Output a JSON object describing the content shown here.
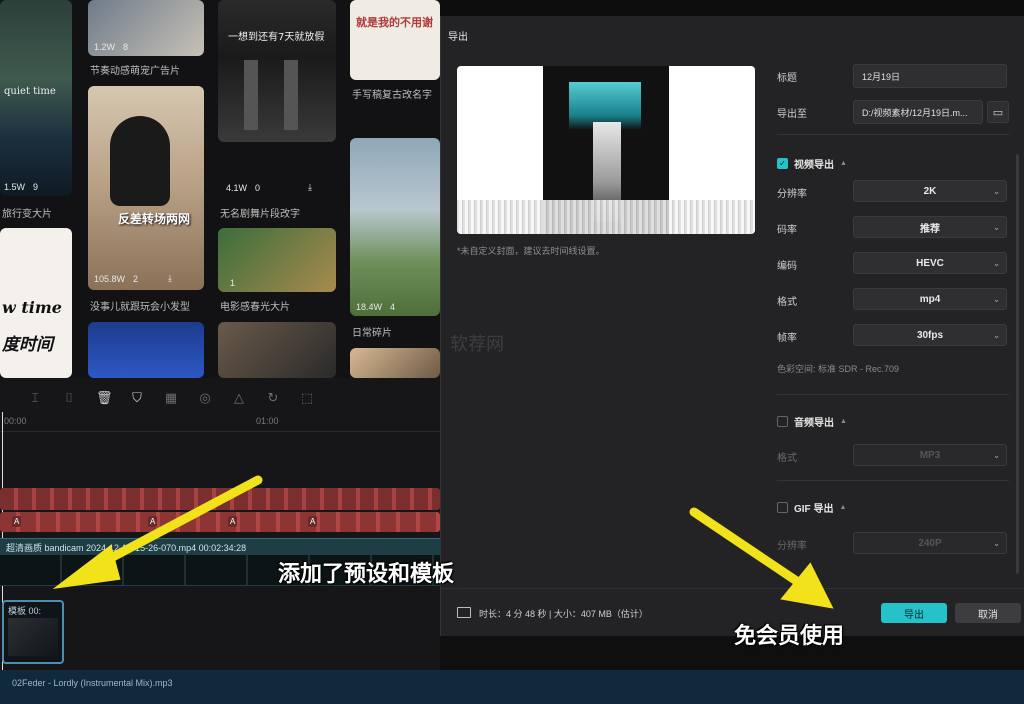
{
  "background": {
    "cards": [
      {
        "caption": "节奏动感萌宠广告片",
        "meta_uses": "1.2W",
        "meta_count": "8"
      },
      {
        "caption": "",
        "overlay": "一想到还有7天就放假"
      },
      {
        "caption": "手写稿复古改名字",
        "overlay": "就是我的不用谢"
      },
      {
        "caption": "旅行变大片",
        "meta_uses": "1.5W",
        "meta_count": "9",
        "overlay": "quiet time"
      },
      {
        "caption": "无名剧舞片段改字",
        "meta_uses": "4.1W",
        "meta_count": "0"
      },
      {
        "caption": "没事儿就跟玩会小发型",
        "meta_uses": "105.8W",
        "meta_count": "2",
        "overlay": "反差转场两网"
      },
      {
        "caption": "电影感春光大片",
        "meta_uses": "",
        "meta_count": "1"
      },
      {
        "caption": "日常碎片",
        "meta_uses": "18.4W",
        "meta_count": "4"
      },
      {
        "caption": "",
        "overlay_line1": "w time",
        "overlay_line2": "度时间"
      }
    ]
  },
  "timeline": {
    "ruler_left": "00:00",
    "ruler_mid": "01:00",
    "video_track_label": "超清画质   bandicam 2024-12-12-15-26-070.mp4   00:02:34:28",
    "template_clip_label": "模板  00:",
    "audio_track_label": "02Feder - Lordly (Instrumental Mix).mp3",
    "red_chip": "A"
  },
  "dialog": {
    "title": "导出",
    "preview_note": "*未自定义封面，建议去时间线设置。",
    "fields": {
      "title_label": "标题",
      "title_value": "12月19日",
      "export_to_label": "导出至",
      "export_to_value": "D:/视频素材/12月19日.m..."
    },
    "video_section": {
      "label": "视频导出",
      "enabled": true,
      "rows": [
        {
          "label": "分辨率",
          "value": "2K"
        },
        {
          "label": "码率",
          "value": "推荐"
        },
        {
          "label": "编码",
          "value": "HEVC"
        },
        {
          "label": "格式",
          "value": "mp4"
        },
        {
          "label": "帧率",
          "value": "30fps"
        }
      ],
      "color_space": "色彩空间:  标准 SDR - Rec.709"
    },
    "audio_section": {
      "label": "音频导出",
      "enabled": false,
      "rows": [
        {
          "label": "格式",
          "value": "MP3"
        }
      ]
    },
    "gif_section": {
      "label": "GIF 导出",
      "enabled": false,
      "rows": [
        {
          "label": "分辨率",
          "value": "240P"
        }
      ]
    },
    "footer": {
      "summary": "时长：4 分 48 秒 | 大小：407 MB（估计）",
      "export_button": "导出",
      "cancel_button": "取消"
    },
    "accent_color": "#26c2c9"
  },
  "annotations": {
    "left": "添加了预设和模板",
    "right": "免会员使用",
    "arrow_color": "#f2e21a"
  },
  "watermark": "软荐网"
}
